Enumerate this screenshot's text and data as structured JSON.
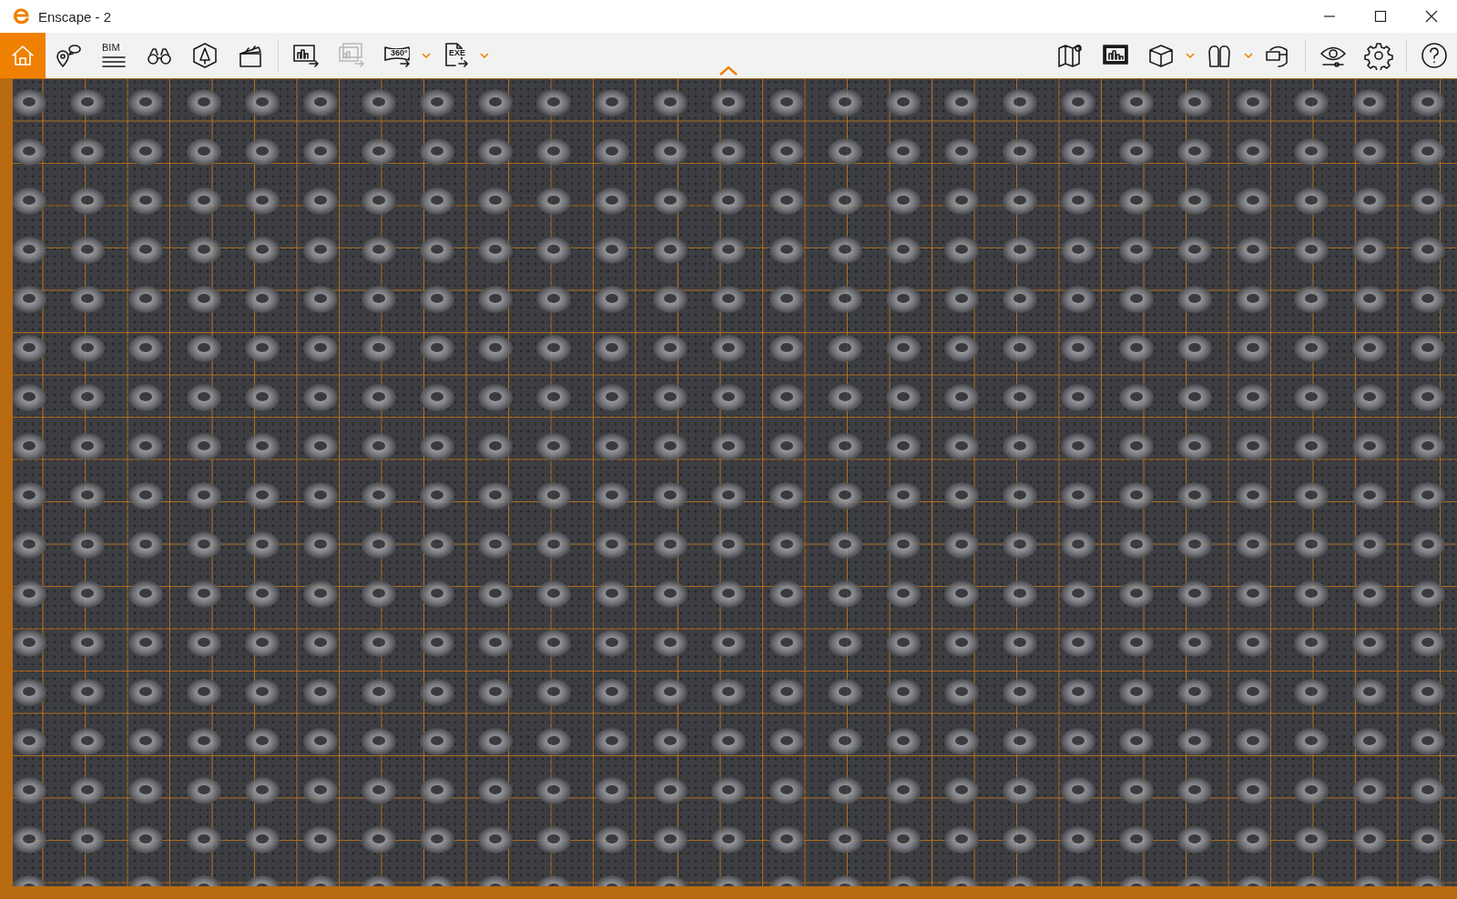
{
  "window": {
    "title": "Enscape - 2"
  },
  "toolbar": {
    "left_groups": [
      [
        {
          "selected": true,
          "disabled": false,
          "dropdown": false
        },
        {
          "selected": false,
          "disabled": false,
          "dropdown": false
        },
        {
          "label": "BIM",
          "selected": false,
          "disabled": false,
          "dropdown": false
        },
        {
          "selected": false,
          "disabled": false,
          "dropdown": false
        },
        {
          "selected": false,
          "disabled": false,
          "dropdown": false
        },
        {
          "selected": false,
          "disabled": false,
          "dropdown": false
        }
      ],
      [
        {
          "selected": false,
          "disabled": false,
          "dropdown": false
        },
        {
          "selected": false,
          "disabled": true,
          "dropdown": false
        },
        {
          "label": "360°",
          "selected": false,
          "disabled": false,
          "dropdown": true
        },
        {
          "label": "EXE",
          "selected": false,
          "disabled": false,
          "dropdown": true
        }
      ]
    ],
    "right_groups": [
      [
        {
          "selected": false,
          "disabled": false,
          "dropdown": false
        },
        {
          "selected": false,
          "disabled": false,
          "dropdown": false
        },
        {
          "selected": false,
          "disabled": false,
          "dropdown": true
        },
        {
          "selected": false,
          "disabled": false,
          "dropdown": true
        },
        {
          "selected": false,
          "disabled": false,
          "dropdown": false
        }
      ],
      [
        {
          "selected": false,
          "disabled": false,
          "dropdown": false
        },
        {
          "selected": false,
          "disabled": false,
          "dropdown": false
        }
      ],
      [
        {
          "selected": false,
          "disabled": false,
          "dropdown": false
        }
      ]
    ]
  }
}
